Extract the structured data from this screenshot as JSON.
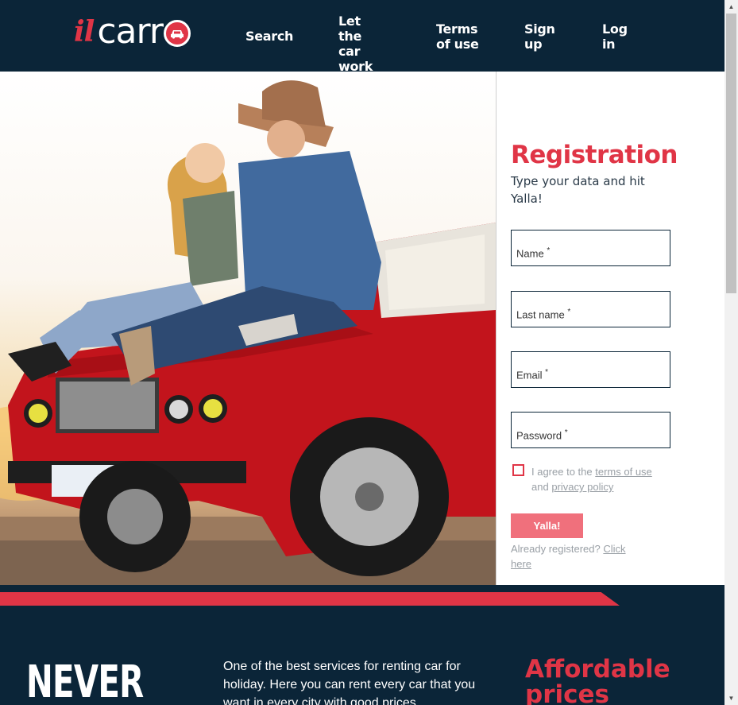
{
  "header": {
    "logo_prefix": "il",
    "logo_main": "carr",
    "nav": {
      "search": "Search",
      "let_car_work": "Let the car work",
      "terms": "Terms of use",
      "signup": "Sign up",
      "login": "Log in"
    }
  },
  "registration": {
    "title": "Registration",
    "subtitle": "Type your data and hit Yalla!",
    "fields": {
      "name": "Name",
      "last_name": "Last name",
      "email": "Email",
      "password": "Password",
      "required_mark": "*"
    },
    "agree_prefix": "I agree to the",
    "terms_link": "terms of use",
    "agree_and": "and",
    "privacy_link": "privacy policy",
    "submit": "Yalla!",
    "already": "Already registered?",
    "click_here": "Click here"
  },
  "promo": {
    "never": "NEVER",
    "about": "One of the best services for renting car for holiday. Here you can rent every car that you want in every city with good prices.",
    "affordable": "Affordable prices"
  },
  "colors": {
    "navy": "#0b2538",
    "accent": "#e03546",
    "button": "#f0707c"
  }
}
